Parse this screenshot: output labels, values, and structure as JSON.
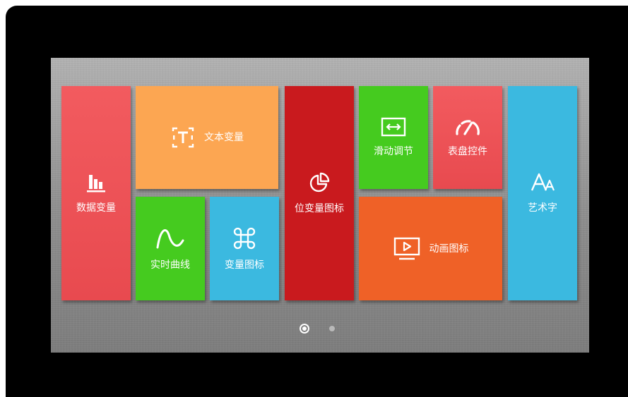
{
  "tiles": {
    "data_variable": {
      "label": "数据变量",
      "color": "#f0555a"
    },
    "text_variable": {
      "label": "文本变量",
      "color": "#fca652"
    },
    "bit_variable_icon": {
      "label": "位变量图标",
      "color": "#c91a1e"
    },
    "slide_adjust": {
      "label": "滑动调节",
      "color": "#45cb1f"
    },
    "dial_control": {
      "label": "表盘控件",
      "color": "#f0555a"
    },
    "art_text": {
      "label": "艺术字",
      "color": "#3bb9e0"
    },
    "realtime_curve": {
      "label": "实时曲线",
      "color": "#45cb1f"
    },
    "variable_icon": {
      "label": "变量图标",
      "color": "#3bb9e0"
    },
    "animation_icon": {
      "label": "动画图标",
      "color": "#ef6127"
    }
  },
  "pagination": {
    "pages": 2,
    "current": 1
  },
  "icons": {
    "data_variable": "bar-chart-icon",
    "text_variable": "text-box-icon",
    "bit_variable_icon": "pie-chart-icon",
    "slide_adjust": "horizontal-arrows-icon",
    "dial_control": "gauge-icon",
    "art_text": "font-icon",
    "realtime_curve": "wave-curve-icon",
    "variable_icon": "command-key-icon",
    "animation_icon": "monitor-play-icon"
  }
}
